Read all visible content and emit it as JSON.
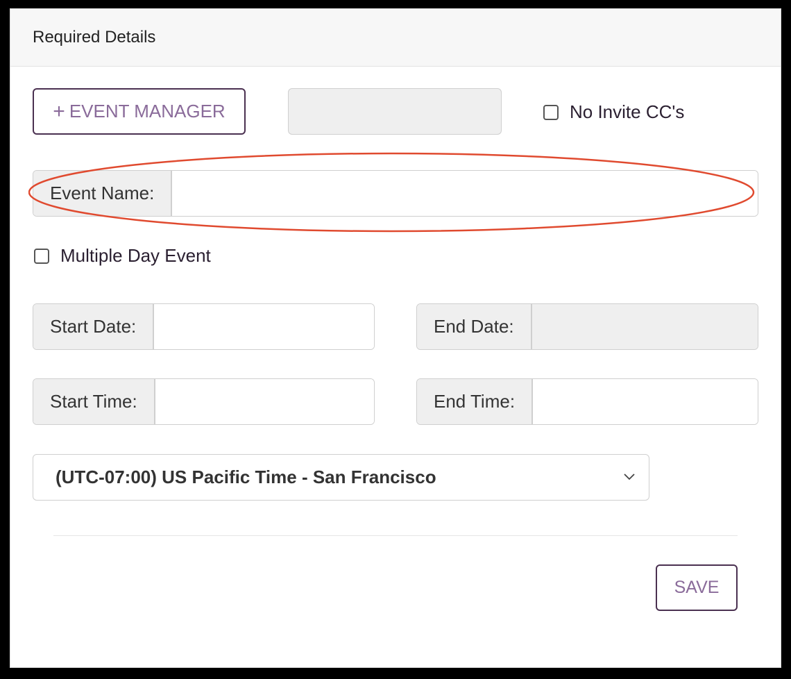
{
  "panel": {
    "title": "Required Details"
  },
  "toolbar": {
    "event_manager_icon": "plus-icon",
    "event_manager_label": "EVENT MANAGER",
    "no_invite_cc_label": "No Invite CC's"
  },
  "event_name": {
    "label": "Event Name:",
    "value": ""
  },
  "multiple_day": {
    "label": "Multiple Day Event",
    "checked": false
  },
  "start_date": {
    "label": "Start Date:",
    "value": ""
  },
  "end_date": {
    "label": "End Date:",
    "value": "",
    "disabled": true
  },
  "start_time": {
    "label": "Start Time:",
    "value": ""
  },
  "end_time": {
    "label": "End Time:",
    "value": ""
  },
  "timezone": {
    "selected": "(UTC-07:00) US Pacific Time - San Francisco"
  },
  "footer": {
    "save_label": "SAVE"
  },
  "annotation": {
    "color": "#e04a2f"
  },
  "colors": {
    "accent": "#4a3050",
    "accent_text": "#8a6b9a"
  }
}
